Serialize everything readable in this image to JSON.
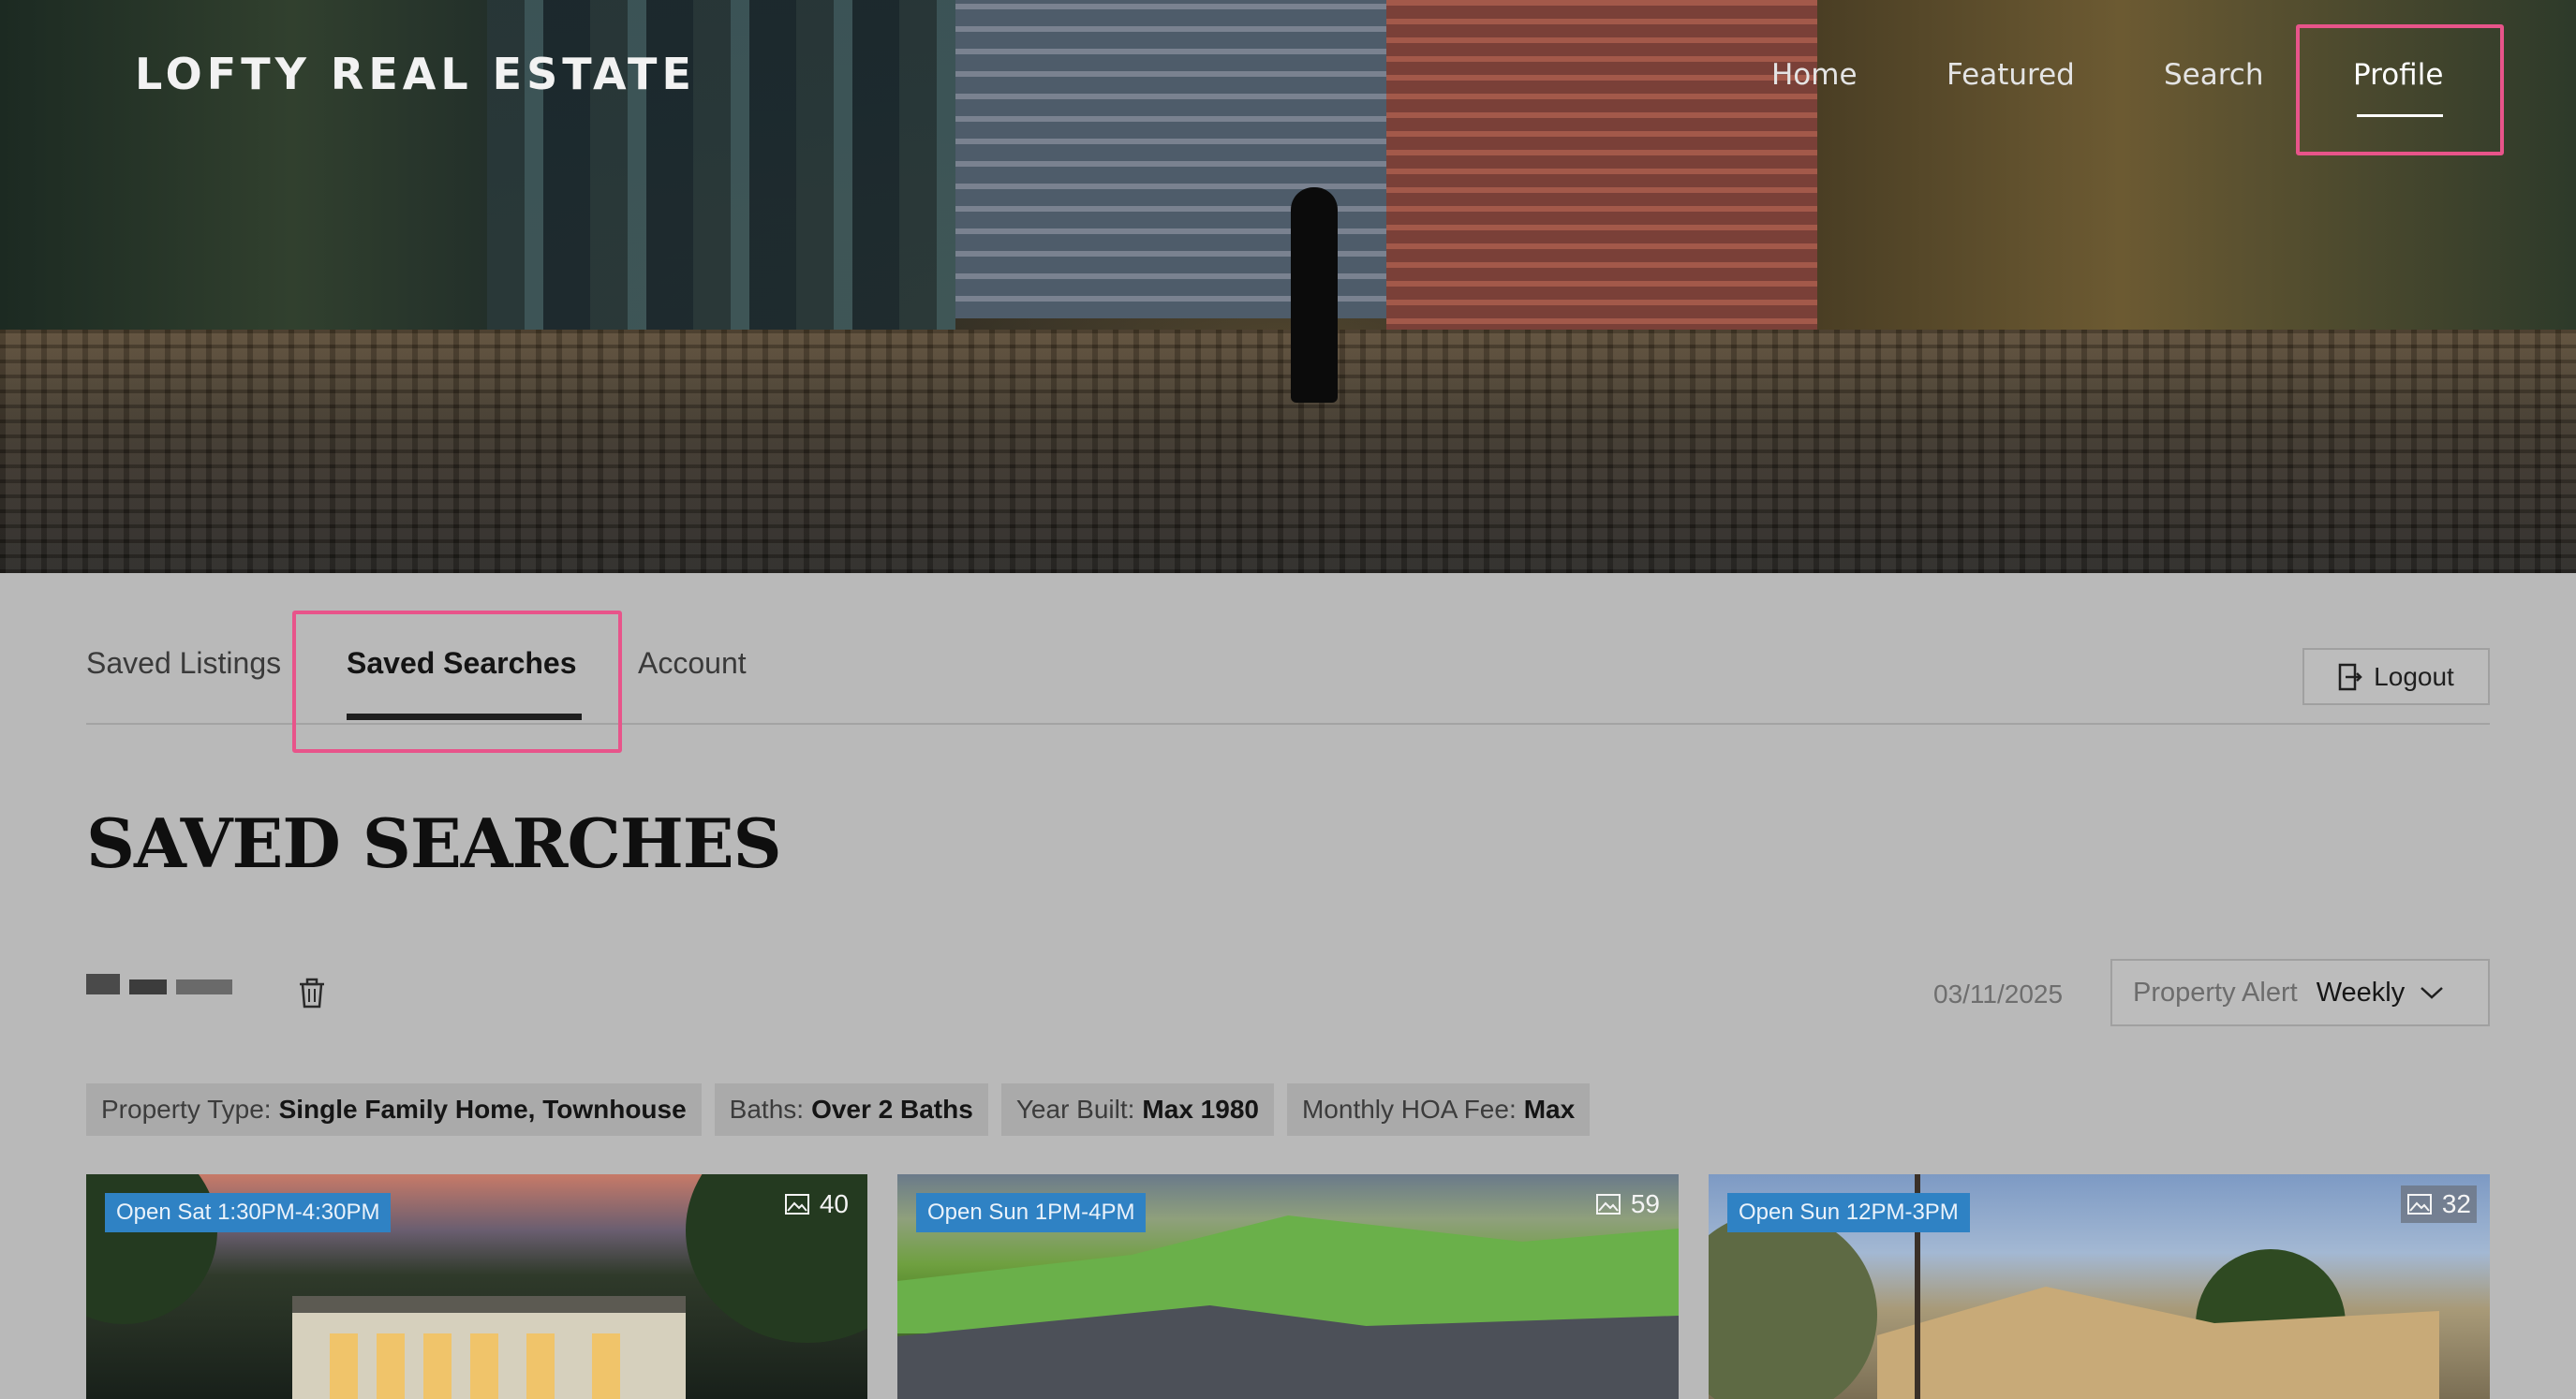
{
  "brand": {
    "logo_text": "LOFTY REAL ESTATE"
  },
  "nav": {
    "items": [
      {
        "label": "Home"
      },
      {
        "label": "Featured"
      },
      {
        "label": "Search"
      },
      {
        "label": "Profile"
      }
    ],
    "active": "Profile"
  },
  "tabs": {
    "items": [
      {
        "label": "Saved Listings"
      },
      {
        "label": "Saved Searches"
      },
      {
        "label": "Account"
      }
    ],
    "active": "Saved Searches"
  },
  "logout": {
    "label": "Logout",
    "icon": "logout-icon"
  },
  "page": {
    "title": "SAVED SEARCHES"
  },
  "saved_search": {
    "date": "03/11/2025",
    "alert": {
      "label": "Property Alert",
      "value": "Weekly"
    },
    "filters": [
      {
        "key": "Property Type:",
        "value": "Single Family Home, Townhouse"
      },
      {
        "key": "Baths:",
        "value": "Over 2 Baths"
      },
      {
        "key": "Year Built:",
        "value": "Max 1980"
      },
      {
        "key": "Monthly HOA Fee:",
        "value": "Max"
      }
    ]
  },
  "listings": [
    {
      "open_house": "Open Sat 1:30PM-4:30PM",
      "photo_count": "40"
    },
    {
      "open_house": "Open Sun 1PM-4PM",
      "photo_count": "59"
    },
    {
      "open_house": "Open Sun 12PM-3PM",
      "photo_count": "32"
    }
  ],
  "colors": {
    "highlight": "#e8548a",
    "badge": "#2f82c4"
  }
}
